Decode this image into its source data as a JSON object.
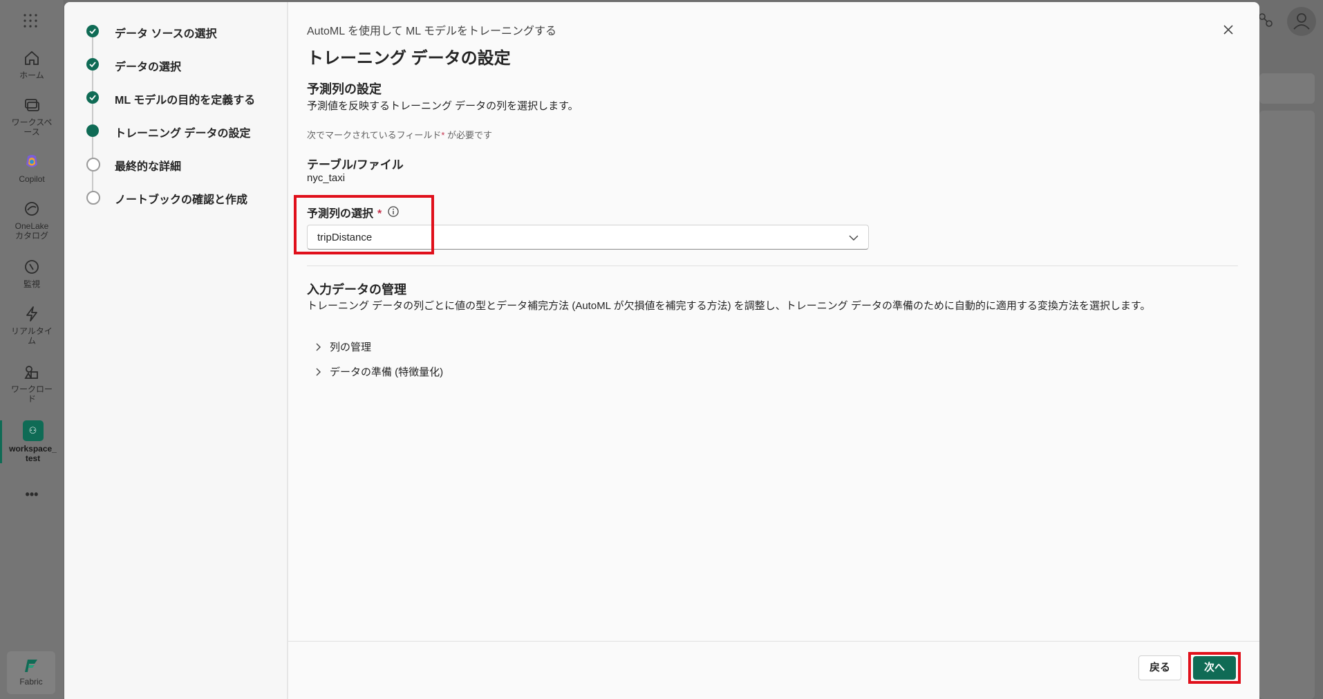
{
  "rail": {
    "items": [
      {
        "label": "ホーム"
      },
      {
        "label": "ワークスペース"
      },
      {
        "label": "Copilot"
      },
      {
        "label": "OneLake カタログ"
      },
      {
        "label": "監視"
      },
      {
        "label": "リアルタイム"
      },
      {
        "label": "ワークロード"
      },
      {
        "label": "workspace_test"
      }
    ],
    "more": "•••",
    "fabric": "Fabric"
  },
  "steps": [
    {
      "label": "データ ソースの選択",
      "state": "done"
    },
    {
      "label": "データの選択",
      "state": "done"
    },
    {
      "label": "ML モデルの目的を定義する",
      "state": "done"
    },
    {
      "label": "トレーニング データの設定",
      "state": "current"
    },
    {
      "label": "最終的な詳細",
      "state": "todo"
    },
    {
      "label": "ノートブックの確認と作成",
      "state": "todo"
    }
  ],
  "header": {
    "pre_title": "AutoML を使用して ML モデルをトレーニングする",
    "title": "トレーニング データの設定"
  },
  "predict": {
    "title": "予測列の設定",
    "desc": "予測値を反映するトレーニング データの列を選択します。",
    "required_note": "次でマークされているフィールド",
    "required_star": "*",
    "required_suffix": " が必要です",
    "table_label": "テーブル/ファイル",
    "table_value": "nyc_taxi",
    "select_label": "予測列の選択",
    "select_value": "tripDistance"
  },
  "manage": {
    "title": "入力データの管理",
    "desc": "トレーニング データの列ごとに値の型とデータ補完方法 (AutoML が欠損値を補完する方法) を調整し、トレーニング データの準備のために自動的に適用する変換方法を選択します。",
    "expanders": [
      "列の管理",
      "データの準備 (特徴量化)"
    ]
  },
  "footer": {
    "back": "戻る",
    "next": "次へ"
  },
  "colors": {
    "accent": "#0f6b55",
    "highlight": "#e0101b",
    "required": "#c4314b"
  }
}
